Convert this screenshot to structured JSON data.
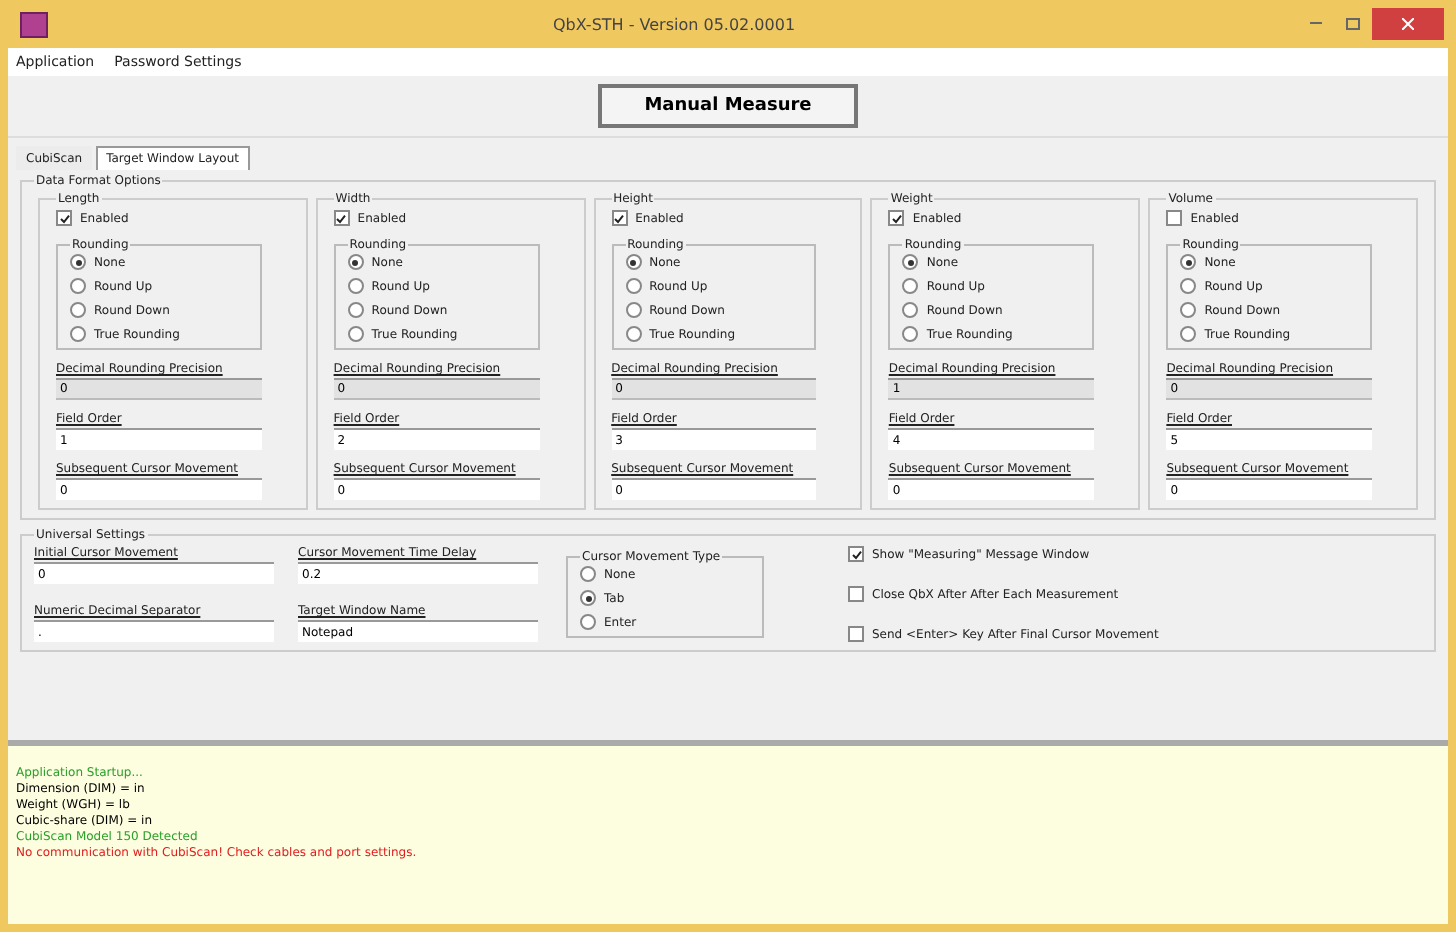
{
  "window": {
    "title": "QbX-STH - Version 05.02.0001"
  },
  "menu": [
    "Application",
    "Password Settings"
  ],
  "toolbar": {
    "button": "Manual Measure"
  },
  "tabs": [
    {
      "label": "CubiScan",
      "selected": false
    },
    {
      "label": "Target Window Layout",
      "selected": true
    }
  ],
  "data_format": {
    "title": "Data Format Options",
    "columns": [
      {
        "title": "Length",
        "enabled_label": "Enabled",
        "enabled": true,
        "rounding_title": "Rounding",
        "options": [
          {
            "label": "None",
            "selected": true
          },
          {
            "label": "Round Up",
            "selected": false
          },
          {
            "label": "Round Down",
            "selected": false
          },
          {
            "label": "True Rounding",
            "selected": false
          }
        ],
        "fields": [
          {
            "label": "Decimal Rounding Precision",
            "value": "0",
            "readonly": true
          },
          {
            "label": "Field Order",
            "value": "1",
            "readonly": false
          },
          {
            "label": "Subsequent Cursor Movement",
            "value": "0",
            "readonly": false
          }
        ]
      },
      {
        "title": "Width",
        "enabled_label": "Enabled",
        "enabled": true,
        "rounding_title": "Rounding",
        "options": [
          {
            "label": "None",
            "selected": true
          },
          {
            "label": "Round Up",
            "selected": false
          },
          {
            "label": "Round Down",
            "selected": false
          },
          {
            "label": "True Rounding",
            "selected": false
          }
        ],
        "fields": [
          {
            "label": "Decimal Rounding Precision",
            "value": "0",
            "readonly": true
          },
          {
            "label": "Field Order",
            "value": "2",
            "readonly": false
          },
          {
            "label": "Subsequent Cursor Movement",
            "value": "0",
            "readonly": false
          }
        ]
      },
      {
        "title": "Height",
        "enabled_label": "Enabled",
        "enabled": true,
        "rounding_title": "Rounding",
        "options": [
          {
            "label": "None",
            "selected": true
          },
          {
            "label": "Round Up",
            "selected": false
          },
          {
            "label": "Round Down",
            "selected": false
          },
          {
            "label": "True Rounding",
            "selected": false
          }
        ],
        "fields": [
          {
            "label": "Decimal Rounding Precision",
            "value": "0",
            "readonly": true
          },
          {
            "label": "Field Order",
            "value": "3",
            "readonly": false
          },
          {
            "label": "Subsequent Cursor Movement",
            "value": "0",
            "readonly": false
          }
        ]
      },
      {
        "title": "Weight",
        "enabled_label": "Enabled",
        "enabled": true,
        "rounding_title": "Rounding",
        "options": [
          {
            "label": "None",
            "selected": true
          },
          {
            "label": "Round Up",
            "selected": false
          },
          {
            "label": "Round Down",
            "selected": false
          },
          {
            "label": "True Rounding",
            "selected": false
          }
        ],
        "fields": [
          {
            "label": "Decimal Rounding Precision",
            "value": "1",
            "readonly": true
          },
          {
            "label": "Field Order",
            "value": "4",
            "readonly": false
          },
          {
            "label": "Subsequent Cursor Movement",
            "value": "0",
            "readonly": false
          }
        ]
      },
      {
        "title": "Volume",
        "enabled_label": "Enabled",
        "enabled": false,
        "rounding_title": "Rounding",
        "options": [
          {
            "label": "None",
            "selected": true
          },
          {
            "label": "Round Up",
            "selected": false
          },
          {
            "label": "Round Down",
            "selected": false
          },
          {
            "label": "True Rounding",
            "selected": false
          }
        ],
        "fields": [
          {
            "label": "Decimal Rounding Precision",
            "value": "0",
            "readonly": true
          },
          {
            "label": "Field Order",
            "value": "5",
            "readonly": false
          },
          {
            "label": "Subsequent Cursor Movement",
            "value": "0",
            "readonly": false
          }
        ]
      }
    ]
  },
  "universal": {
    "title": "Universal Settings",
    "fields": [
      {
        "label": "Initial Cursor Movement",
        "value": "0"
      },
      {
        "label": "Cursor Movement Time Delay",
        "value": "0.2"
      },
      {
        "label": "Numeric Decimal Separator",
        "value": "."
      },
      {
        "label": "Target Window Name",
        "value": "Notepad"
      }
    ],
    "movement_type": {
      "title": "Cursor Movement Type",
      "options": [
        {
          "label": "None",
          "selected": false
        },
        {
          "label": "Tab",
          "selected": true
        },
        {
          "label": "Enter",
          "selected": false
        }
      ]
    },
    "checks": [
      {
        "label": "Show \"Measuring\" Message Window",
        "checked": true
      },
      {
        "label": "Close QbX After After Each Measurement",
        "checked": false
      },
      {
        "label": "Send <Enter> Key After Final Cursor Movement",
        "checked": false
      }
    ]
  },
  "log": [
    {
      "text": "Application Startup...",
      "color": "#2aa02a"
    },
    {
      "text": "Dimension (DIM) = in",
      "color": "#000000"
    },
    {
      "text": "Weight (WGH) = lb",
      "color": "#000000"
    },
    {
      "text": "Cubic-share (DIM) = in",
      "color": "#000000"
    },
    {
      "text": "CubiScan Model 150 Detected",
      "color": "#2aa02a"
    },
    {
      "text": "No communication with CubiScan! Check cables and port settings.",
      "color": "#e02020"
    }
  ]
}
